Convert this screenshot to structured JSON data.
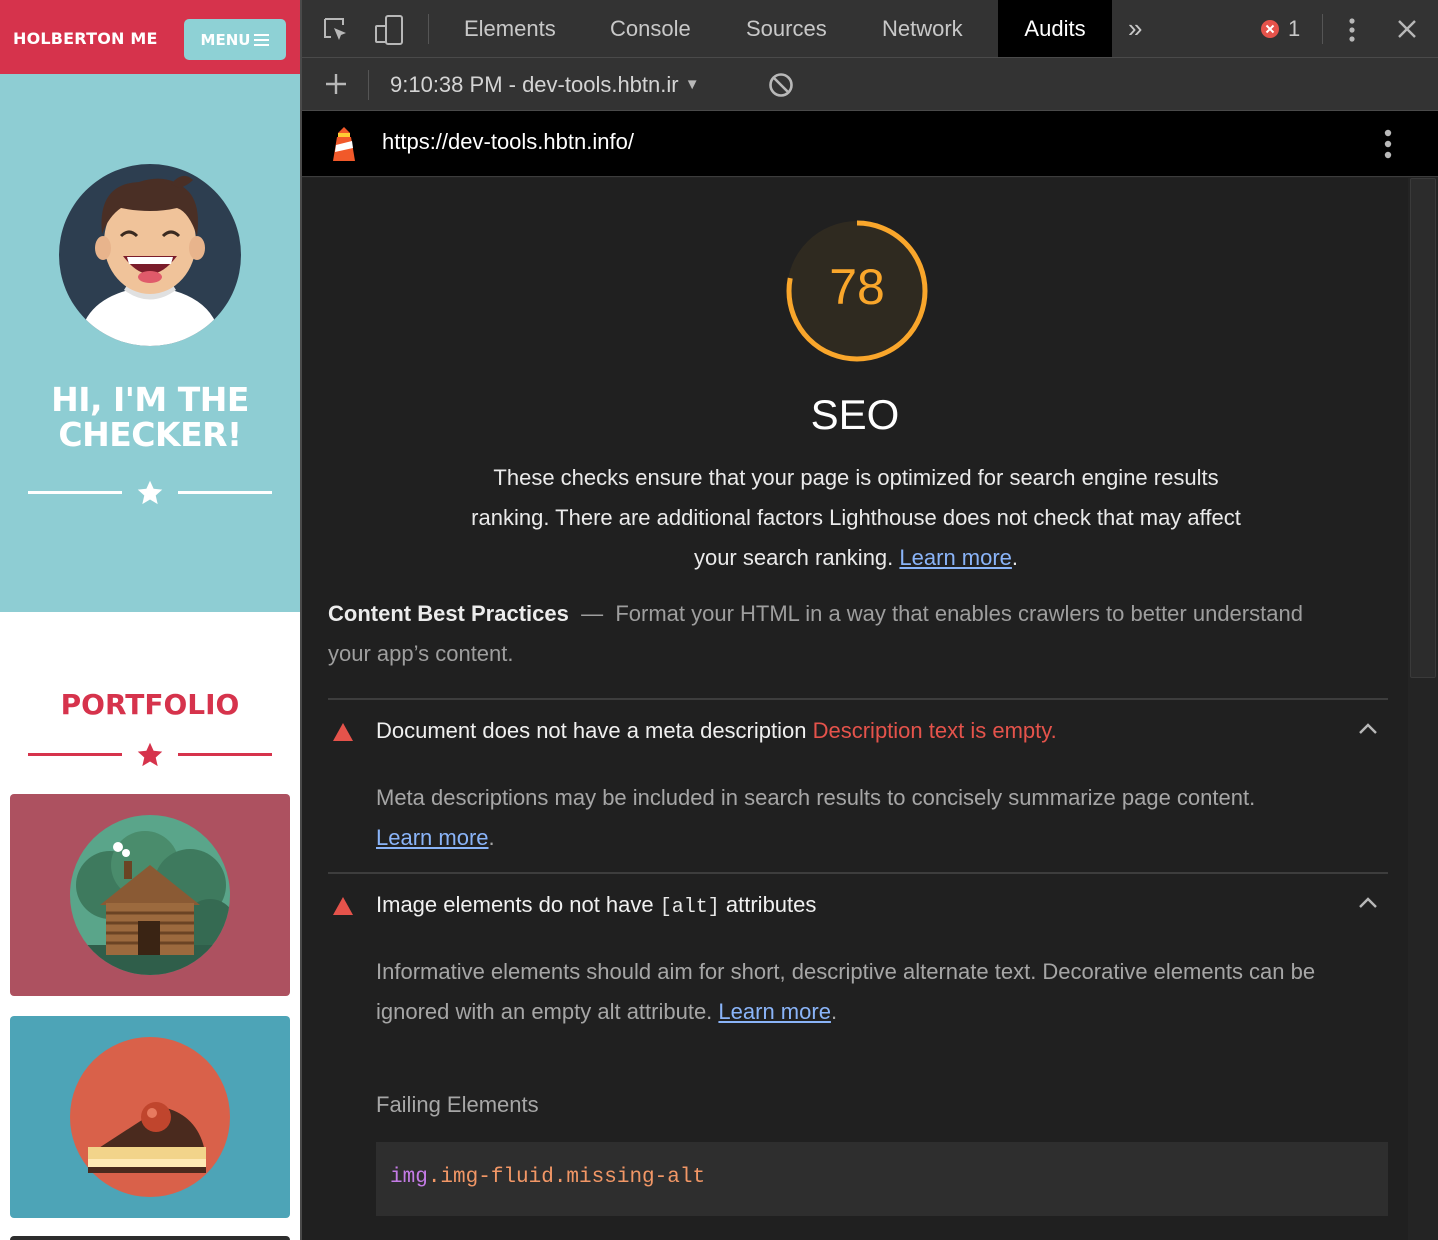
{
  "site": {
    "brand": "HOLBERTON ME",
    "menu_label": "MENU",
    "hero_line1": "HI, I'M THE",
    "hero_line2": "CHECKER!",
    "portfolio_title": "PORTFOLIO",
    "colors": {
      "brand_red": "#d6334c",
      "hero_teal": "#8ecdd3",
      "card_rose": "#ad5160",
      "card_teal": "#4da4b7"
    }
  },
  "devtools": {
    "tabs": [
      "Elements",
      "Console",
      "Sources",
      "Network",
      "Audits"
    ],
    "active_tab": "Audits",
    "error_count": "1",
    "session_label": "9:10:38 PM - dev-tools.hbtn.ir",
    "url": "https://dev-tools.hbtn.info/"
  },
  "report": {
    "score": "78",
    "category": "SEO",
    "description": "These checks ensure that your page is optimized for search engine results ranking. There are additional factors Lighthouse does not check that may affect your search ranking.",
    "learn_more": "Learn more",
    "group_title": "Content Best Practices",
    "group_desc": "Format your HTML in a way that enables crawlers to better understand your app’s content.",
    "audits": [
      {
        "title": "Document does not have a meta description",
        "error": "Description text is empty.",
        "description": "Meta descriptions may be included in search results to concisely summarize page content.",
        "learn_more": "Learn more"
      },
      {
        "title_before": "Image elements do not have",
        "title_code": "[alt]",
        "title_after": "attributes",
        "description": "Informative elements should aim for short, descriptive alternate text. Decorative elements can be ignored with an empty alt attribute.",
        "learn_more": "Learn more",
        "failing_label": "Failing Elements",
        "failing_tag": "img",
        "failing_classes": ".img-fluid.missing-alt"
      }
    ],
    "gauge_color": "#f9a62b",
    "fail_color": "#e5534b"
  }
}
